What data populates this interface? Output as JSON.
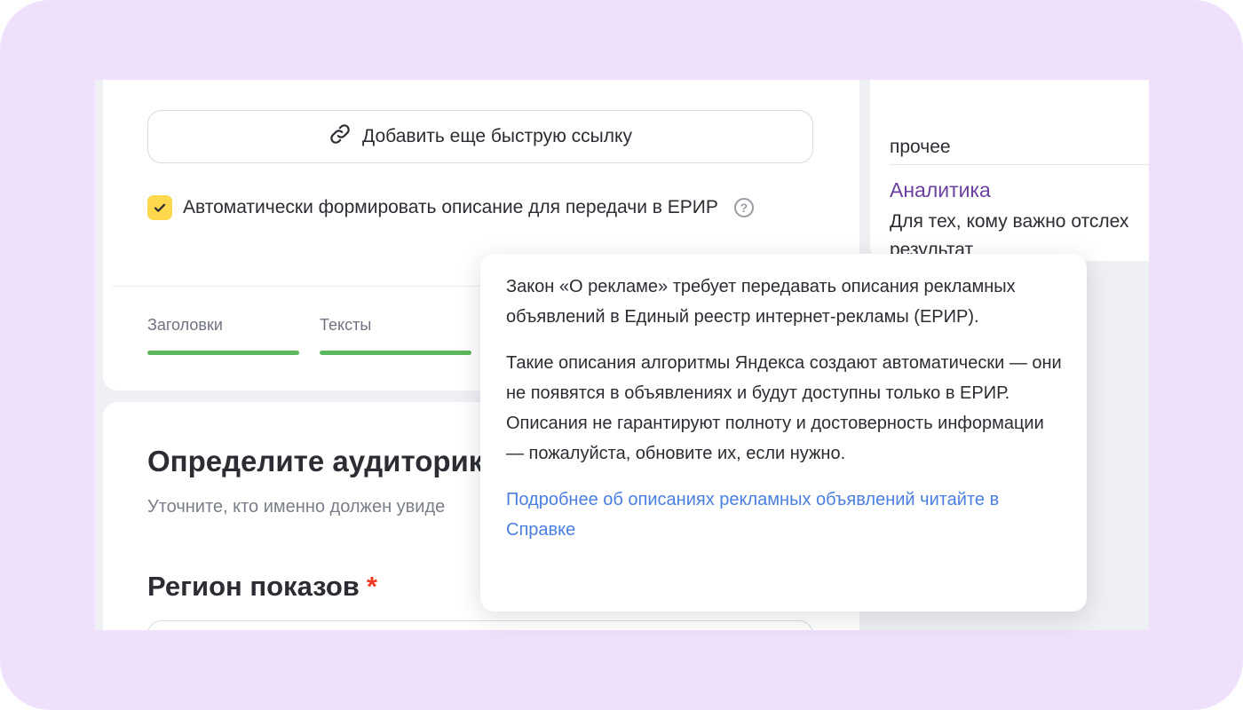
{
  "form": {
    "quick_link_button": "Добавить еще быструю ссылку",
    "erir_checkbox": {
      "label": "Автоматически формировать описание для передачи в ЕРИР",
      "checked": true,
      "help_glyph": "?"
    },
    "metrics": [
      {
        "label": "Заголовки"
      },
      {
        "label": "Тексты"
      }
    ],
    "audience": {
      "title": "Определите аудиторик",
      "subtitle": "Уточните, кто именно должен увиде"
    },
    "region": {
      "title": "Регион показов",
      "required_mark": "*"
    }
  },
  "side_panel": {
    "prev_tail": "прочее",
    "heading": "Аналитика",
    "description_line1": "Для тех, кому важно отслех",
    "description_line2": "результат"
  },
  "tooltip": {
    "paragraph1": "Закон «О рекламе» требует передавать описания рекламных объявлений в Единый реестр интернет-рекламы (ЕРИР).",
    "paragraph2": "Такие описания алгоритмы Яндекса создают автоматически — они не появятся в объявлениях и будут доступны только в ЕРИР. Описания не гарантируют полноту и достоверность информации — пожалуйста, обновите их, если нужно.",
    "link": "Подробнее об описаниях рекламных объявлений читайте в Справке"
  },
  "colors": {
    "frame_background": "#efe1fb",
    "checkbox_accent": "#ffd84d",
    "progress_green": "#5cb85c",
    "link_blue": "#4a7fe0",
    "heading_purple": "#6a3fa0",
    "required_red": "#ef3b24"
  },
  "icons": {
    "quick_link": "link-icon",
    "checkbox": "checkmark-icon",
    "help": "question-circle-icon"
  }
}
